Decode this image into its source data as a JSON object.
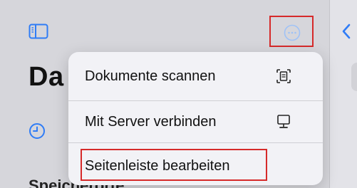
{
  "header": {
    "sidebar_toggle_icon": "sidebar-toggle-icon",
    "more_icon": "ellipsis-circle-icon",
    "back_icon": "chevron-left-icon"
  },
  "sidebar": {
    "title": "Da",
    "recent_icon": "clock-icon",
    "section_peek": "Speicherorte"
  },
  "menu": {
    "items": [
      {
        "label": "Dokumente scannen",
        "icon": "doc-scan-icon"
      },
      {
        "label": "Mit Server verbinden",
        "icon": "display-icon"
      },
      {
        "label": "Seitenleiste bearbeiten"
      }
    ]
  },
  "colors": {
    "accent": "#2f7cf6",
    "highlight_border": "#d62a2a",
    "menu_bg": "#f2f2f6",
    "sidebar_bg": "#d6d6db"
  }
}
